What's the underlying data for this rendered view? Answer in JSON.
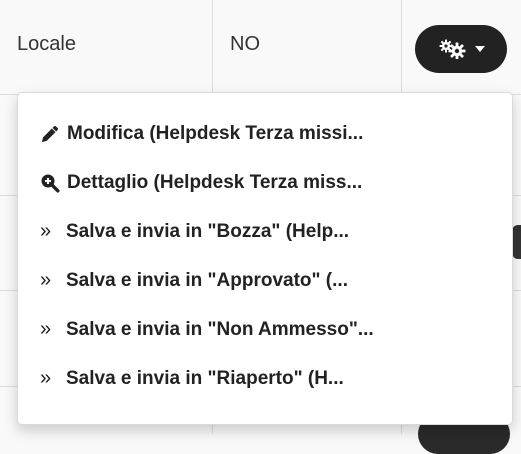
{
  "table": {
    "row": {
      "col_type": "Locale",
      "col_flag": "NO"
    }
  },
  "actions_button": {
    "icon": "gears-icon",
    "caret": "caret-down-icon"
  },
  "menu": {
    "items": [
      {
        "icon": "pencil-icon",
        "label": "Modifica (Helpdesk Terza missi..."
      },
      {
        "icon": "zoom-in-icon",
        "label": "Dettaglio (Helpdesk Terza miss..."
      },
      {
        "icon": "double-chevron-right-icon",
        "glyph": "»",
        "label": "Salva e invia in \"Bozza\" (Help..."
      },
      {
        "icon": "double-chevron-right-icon",
        "glyph": "»",
        "label": "Salva e invia in \"Approvato\" (..."
      },
      {
        "icon": "double-chevron-right-icon",
        "glyph": "»",
        "label": "Salva e invia in \"Non Ammesso\"..."
      },
      {
        "icon": "double-chevron-right-icon",
        "glyph": "»",
        "label": "Salva e invia in \"Riaperto\" (H..."
      }
    ]
  }
}
